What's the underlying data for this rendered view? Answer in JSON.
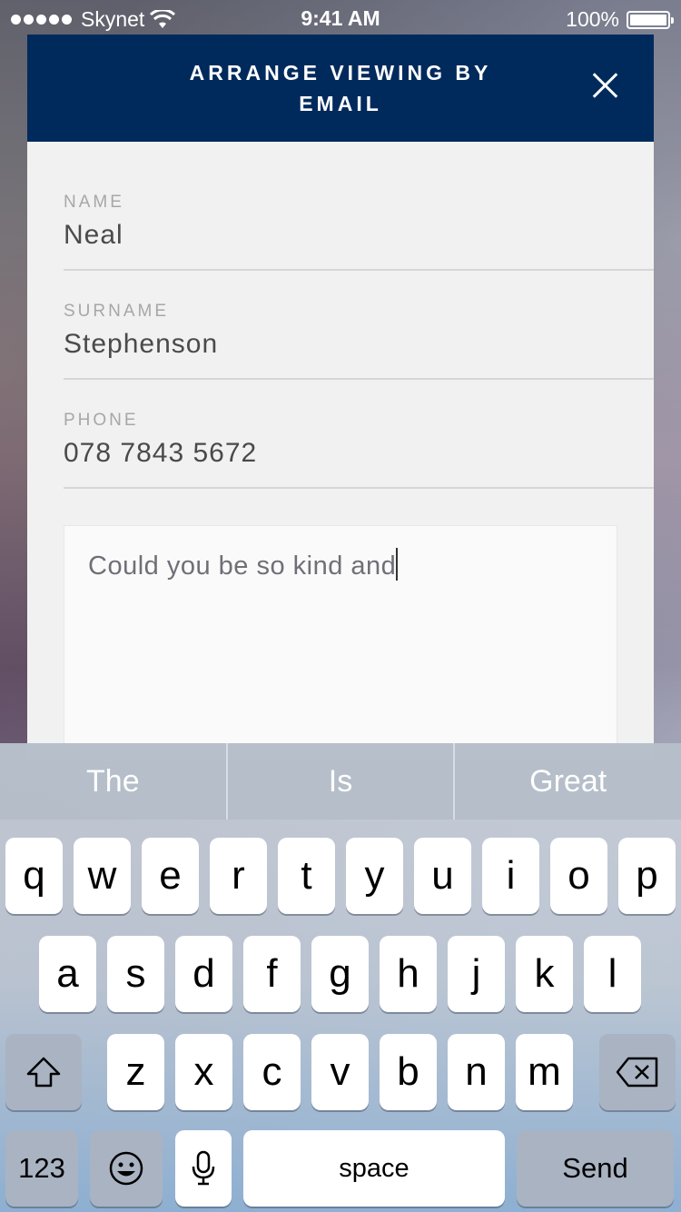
{
  "status_bar": {
    "carrier": "Skynet",
    "time": "9:41 AM",
    "battery": "100%",
    "battery_level": 1.0
  },
  "modal": {
    "title": "ARRANGE VIEWING BY EMAIL",
    "close_icon": "close-icon",
    "fields": [
      {
        "label": "NAME",
        "value": "Neal"
      },
      {
        "label": "SURNAME",
        "value": "Stephenson"
      },
      {
        "label": "PHONE",
        "value": "078 7843 5672"
      }
    ],
    "message": "Could you be so kind and"
  },
  "colors": {
    "header": "#012a5c",
    "modal_bg": "#f1f1f1"
  },
  "keyboard": {
    "suggestions": [
      "The",
      "Is",
      "Great"
    ],
    "rows": [
      [
        "q",
        "w",
        "e",
        "r",
        "t",
        "y",
        "u",
        "i",
        "o",
        "p"
      ],
      [
        "a",
        "s",
        "d",
        "f",
        "g",
        "h",
        "j",
        "k",
        "l"
      ],
      [
        "z",
        "x",
        "c",
        "v",
        "b",
        "n",
        "m"
      ]
    ],
    "numbers_label": "123",
    "space_label": "space",
    "send_label": "Send",
    "icons": {
      "shift": "shift-icon",
      "delete": "backspace-icon",
      "emoji": "emoji-icon",
      "mic": "microphone-icon"
    }
  }
}
